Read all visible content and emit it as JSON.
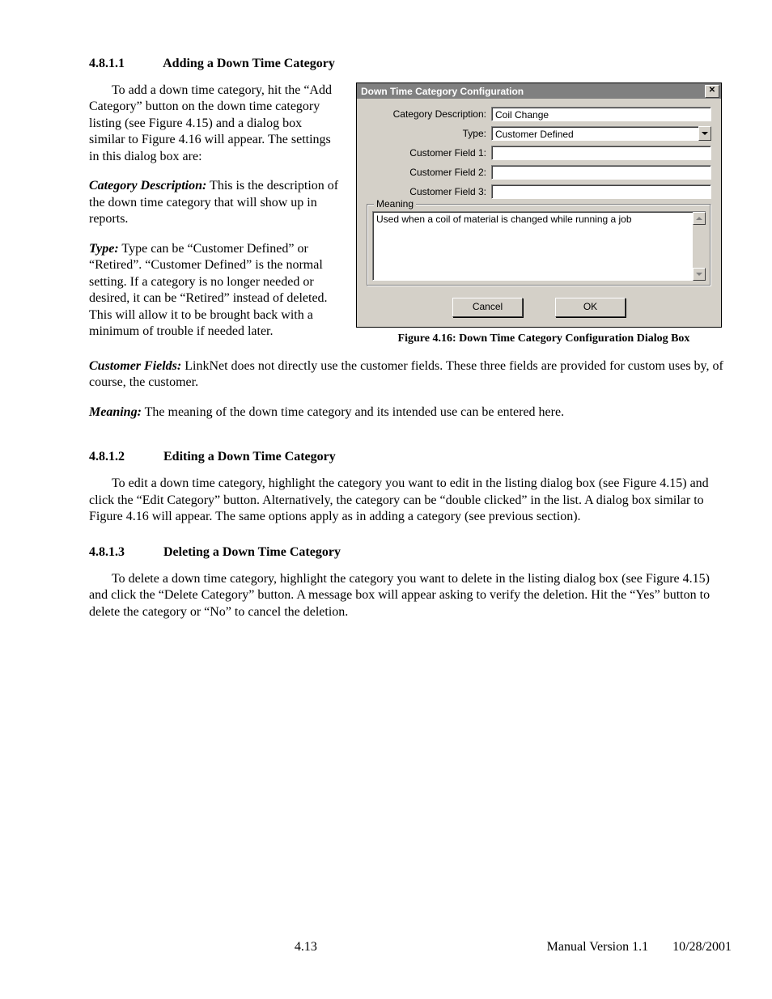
{
  "section1": {
    "num": "4.8.1.1",
    "title": "Adding a Down Time Category",
    "left_paras": {
      "intro": "To add a down time category, hit the “Add Category” button on the down time category listing (see Figure 4.15) and a dialog box similar to Figure 4.16 will appear.  The settings in this dialog box are:",
      "catdesc_label": "Category Description:",
      "catdesc_body": "  This is the description of the down time category that will show up in reports.",
      "type_label": "Type:",
      "type_body": "  Type can be “Customer Defined” or “Retired”.  “Customer Defined” is the normal setting.  If a category is no longer needed or desired, it can be “Retired” instead of deleted.  This will allow it to be brought back with a minimum of trouble if needed later."
    },
    "full_paras": {
      "cust_label": "Customer Fields:",
      "cust_body": "  LinkNet does not directly use the customer fields.  These three fields are provided for custom uses by, of course, the customer.",
      "meaning_label": "Meaning:",
      "meaning_body": "  The meaning of the down time category and its intended use can be entered here."
    }
  },
  "dialog": {
    "title": "Down Time Category Configuration",
    "close": "✕",
    "labels": {
      "catdesc": "Category Description:",
      "type": "Type:",
      "cf1": "Customer Field 1:",
      "cf2": "Customer Field 2:",
      "cf3": "Customer Field 3:",
      "meaning_group": "Meaning"
    },
    "values": {
      "catdesc": "Coil Change",
      "type": "Customer Defined",
      "cf1": "",
      "cf2": "",
      "cf3": "",
      "meaning_text": "Used when a coil of material is changed while running a job"
    },
    "buttons": {
      "cancel": "Cancel",
      "ok": "OK"
    }
  },
  "figure_caption": "Figure 4.16: Down Time Category Configuration Dialog Box",
  "section2": {
    "num": "4.8.1.2",
    "title": "Editing a Down Time Category",
    "body": "To edit a down time category, highlight the category you want to edit in the listing dialog box (see Figure 4.15) and click the “Edit Category” button.  Alternatively, the category can be “double clicked” in the list.  A dialog box similar to Figure 4.16 will appear.  The same options apply as in adding a category (see previous section)."
  },
  "section3": {
    "num": "4.8.1.3",
    "title": "Deleting a Down Time Category",
    "body": "To delete a down time category, highlight the category you want to delete in the listing dialog box (see Figure 4.15) and click the “Delete Category” button.  A message box will appear asking to verify the deletion.  Hit the “Yes” button to delete the category or “No” to cancel the deletion."
  },
  "footer": {
    "pagenum": "4.13",
    "version": "Manual Version 1.1",
    "date": "10/28/2001"
  }
}
